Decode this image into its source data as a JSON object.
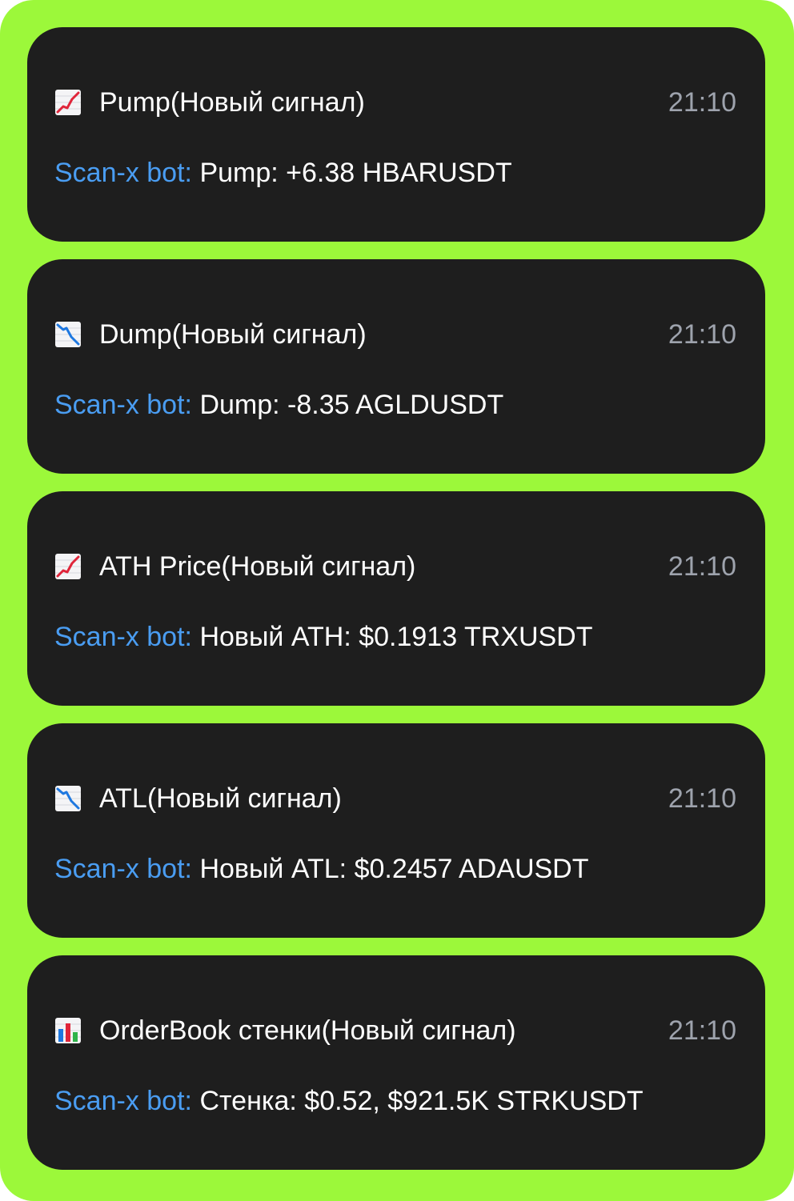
{
  "colors": {
    "frame_background": "#9cf83a",
    "card_background": "#1e1e1e",
    "sender_color": "#4a9df2",
    "time_color": "#9ea3ad"
  },
  "notifications": [
    {
      "icon": "chart-increasing-icon",
      "title": "Pump(Новый сигнал)",
      "time": "21:10",
      "sender": "Scan-x bot:",
      "text": "Pump: +6.38 HBARUSDT"
    },
    {
      "icon": "chart-decreasing-icon",
      "title": "Dump(Новый сигнал)",
      "time": "21:10",
      "sender": "Scan-x bot:",
      "text": "Dump: -8.35 AGLDUSDT"
    },
    {
      "icon": "chart-increasing-icon",
      "title": "ATH Price(Новый сигнал)",
      "time": "21:10",
      "sender": "Scan-x bot:",
      "text": "Новый ATH: $0.1913 TRXUSDT"
    },
    {
      "icon": "chart-decreasing-icon",
      "title": "ATL(Новый сигнал)",
      "time": "21:10",
      "sender": "Scan-x bot:",
      "text": "Новый ATL: $0.2457 ADAUSDT"
    },
    {
      "icon": "bar-chart-icon",
      "title": "OrderBook стенки(Новый сигнал)",
      "time": "21:10",
      "sender": "Scan-x bot:",
      "text": "Стенка: $0.52, $921.5K STRKUSDT"
    }
  ]
}
